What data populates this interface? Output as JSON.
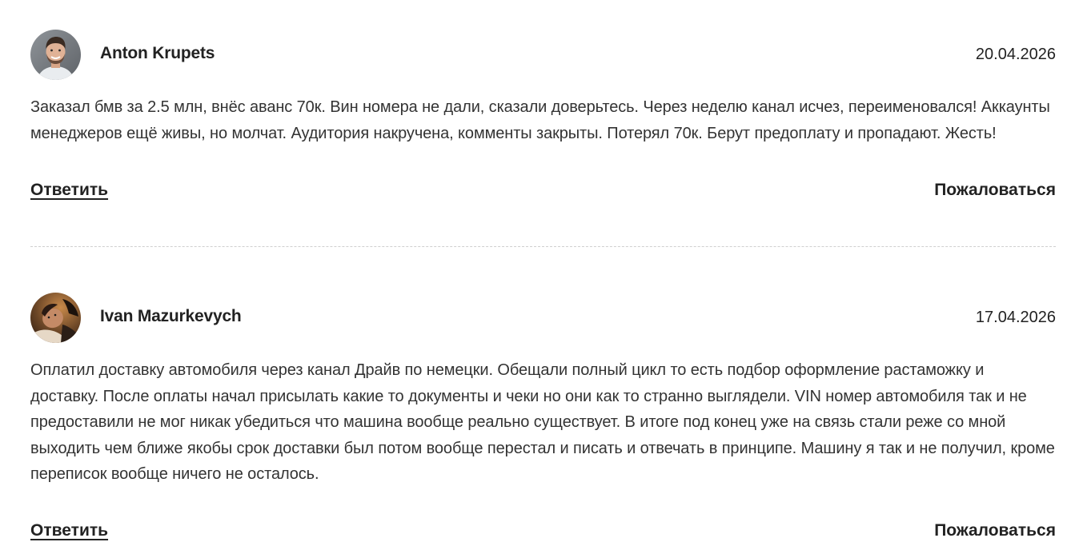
{
  "comments": [
    {
      "author": "Anton Krupets",
      "date": "20.04.2026",
      "text": "Заказал бмв за 2.5 млн, внёс аванс 70к. Вин номера не дали, сказали доверьтесь. Через неделю канал исчез, переименовался! Аккаунты менеджеров ещё живы, но молчат. Аудитория накручена, комменты закрыты. Потерял 70к. Берут предоплату и пропадают. Жесть!",
      "reply_label": "Ответить",
      "report_label": "Пожаловаться"
    },
    {
      "author": "Ivan Mazurkevych",
      "date": "17.04.2026",
      "text": "Оплатил доставку автомобиля через канал Драйв по немецки. Обещали полный цикл то есть подбор оформление растаможку и доставку. После оплаты начал присылать какие то документы и чеки но они как то странно выглядели. VIN номер автомобиля так и не предоставили не мог никак убедиться что машина вообще реально существует. В итоге под конец уже на связь стали реже со мной выходить чем ближе якобы срок доставки был потом вообще перестал и писать и отвечать в принципе. Машину я так и не получил, кроме переписок вообще ничего не осталось.",
      "reply_label": "Ответить",
      "report_label": "Пожаловаться"
    }
  ]
}
